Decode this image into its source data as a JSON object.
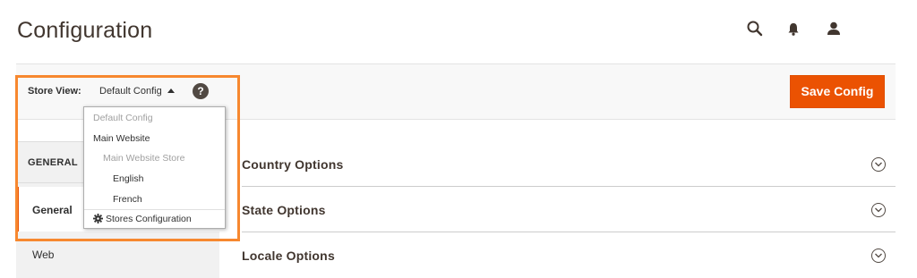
{
  "header": {
    "title": "Configuration",
    "icons": [
      "search-icon",
      "bell-icon",
      "user-icon"
    ]
  },
  "toolbar": {
    "store_view_label": "Store View:",
    "store_view_value": "Default Config",
    "help_symbol": "?",
    "save_label": "Save Config"
  },
  "store_view_dropdown": {
    "items": [
      {
        "label": "Default Config",
        "state": "disabled"
      },
      {
        "label": "Main Website",
        "state": "enabled"
      },
      {
        "label": "Main Website Store",
        "state": "disabled"
      },
      {
        "label": "English",
        "state": "enabled"
      },
      {
        "label": "French",
        "state": "enabled"
      },
      {
        "label": "Stores Configuration",
        "state": "enabled",
        "icon": "gear-icon"
      }
    ]
  },
  "sidebar": {
    "group_title": "GENERAL",
    "items": [
      {
        "label": "General",
        "active": true
      },
      {
        "label": "Web",
        "active": false
      }
    ]
  },
  "sections": [
    {
      "title": "Country Options"
    },
    {
      "title": "State Options"
    },
    {
      "title": "Locale Options"
    }
  ],
  "colors": {
    "accent": "#eb5202",
    "highlight_border": "#f7882f",
    "title_text": "#41362f",
    "sidebar_bg": "#f1f1f1",
    "toolbar_bg": "#f8f8f8"
  }
}
